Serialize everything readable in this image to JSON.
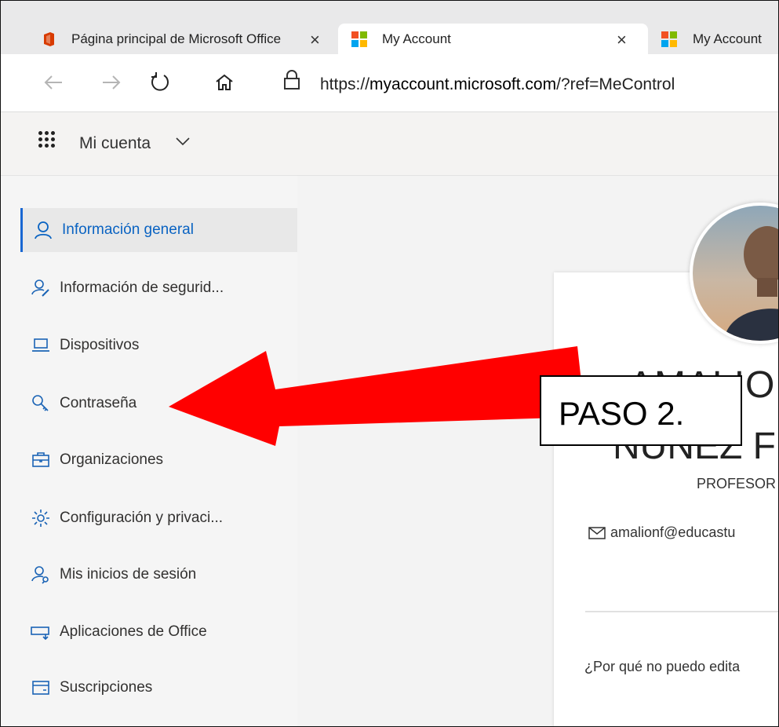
{
  "browser": {
    "tabs": [
      {
        "label": "Página principal de Microsoft Office",
        "close": "×",
        "favicon": "office-icon"
      },
      {
        "label": "My Account",
        "close": "×",
        "favicon": "microsoft-logo-icon"
      },
      {
        "label": "My Account",
        "favicon": "microsoft-logo-icon"
      }
    ],
    "url_prefix": "https://",
    "url_domain": "myaccount.microsoft.com",
    "url_rest": "/?ref=MeControl"
  },
  "suite": {
    "app_title": "Mi cuenta"
  },
  "sidebar": {
    "items": [
      {
        "label": "Información general",
        "icon": "person-icon",
        "active": true
      },
      {
        "label": "Información de segurid...",
        "icon": "person-key-icon"
      },
      {
        "label": "Dispositivos",
        "icon": "laptop-icon"
      },
      {
        "label": "Contraseña",
        "icon": "key-icon"
      },
      {
        "label": "Organizaciones",
        "icon": "briefcase-icon"
      },
      {
        "label": "Configuración y privaci...",
        "icon": "gear-icon"
      },
      {
        "label": "Mis inicios de sesión",
        "icon": "person-signin-icon"
      },
      {
        "label": "Aplicaciones de Office",
        "icon": "office-apps-icon"
      },
      {
        "label": "Suscripciones",
        "icon": "card-icon"
      }
    ]
  },
  "profile": {
    "name_line1": "AMALIO V",
    "name_line2": "NUÑEZ FER",
    "role": "PROFESOR",
    "email": "amalionf@educastu",
    "why_edit": "¿Por qué no puedo edita"
  },
  "annotation": {
    "label": "PASO 2."
  },
  "colors": {
    "accent": "#0a63c2",
    "arrow": "#ff0000",
    "sidebar_bg": "#f5f5f5"
  }
}
